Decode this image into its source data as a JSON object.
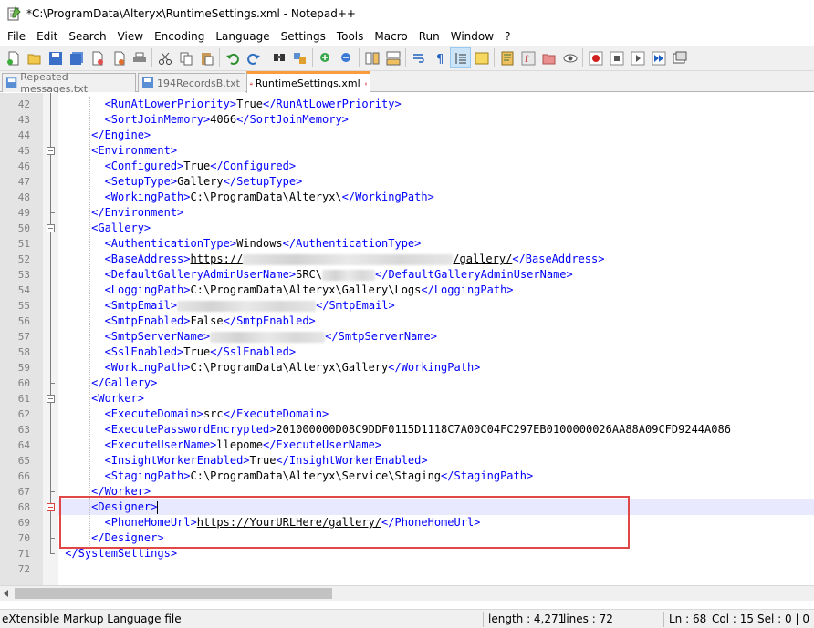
{
  "window": {
    "title": "*C:\\ProgramData\\Alteryx\\RuntimeSettings.xml - Notepad++"
  },
  "menu": [
    "File",
    "Edit",
    "Search",
    "View",
    "Encoding",
    "Language",
    "Settings",
    "Tools",
    "Macro",
    "Run",
    "Window",
    "?"
  ],
  "tabs": [
    {
      "label": "Repeated messages.txt",
      "active": false
    },
    {
      "label": "194RecordsB.txt",
      "active": false
    },
    {
      "label": "RuntimeSettings.xml",
      "active": true
    }
  ],
  "editor": {
    "current_line": 68,
    "lines": [
      {
        "num": "42",
        "segs": [
          [
            "t",
            "<RunAtLowerPriority>"
          ],
          [
            "v",
            "True"
          ],
          [
            "t",
            "</RunAtLowerPriority>"
          ]
        ]
      },
      {
        "num": "43",
        "segs": [
          [
            "t",
            "<SortJoinMemory>"
          ],
          [
            "v",
            "4066"
          ],
          [
            "t",
            "</SortJoinMemory>"
          ]
        ]
      },
      {
        "num": "44",
        "segs": [
          [
            "t",
            "</Engine>"
          ]
        ]
      },
      {
        "num": "45",
        "segs": [
          [
            "t",
            "<Environment>"
          ]
        ]
      },
      {
        "num": "46",
        "segs": [
          [
            "t",
            "<Configured>"
          ],
          [
            "v",
            "True"
          ],
          [
            "t",
            "</Configured>"
          ]
        ]
      },
      {
        "num": "47",
        "segs": [
          [
            "t",
            "<SetupType>"
          ],
          [
            "v",
            "Gallery"
          ],
          [
            "t",
            "</SetupType>"
          ]
        ]
      },
      {
        "num": "48",
        "segs": [
          [
            "t",
            "<WorkingPath>"
          ],
          [
            "v",
            "C:\\ProgramData\\Alteryx\\"
          ],
          [
            "t",
            "</WorkingPath>"
          ]
        ]
      },
      {
        "num": "49",
        "segs": [
          [
            "t",
            "</Environment>"
          ]
        ]
      },
      {
        "num": "50",
        "segs": [
          [
            "t",
            "<Gallery>"
          ]
        ]
      },
      {
        "num": "51",
        "segs": [
          [
            "t",
            "<AuthenticationType>"
          ],
          [
            "v",
            "Windows"
          ],
          [
            "t",
            "</AuthenticationType>"
          ]
        ]
      },
      {
        "num": "52",
        "segs": [
          [
            "t",
            "<BaseAddress>"
          ],
          [
            "u",
            "https://"
          ],
          [
            "b",
            "",
            ""
          ],
          [
            "u",
            "/gallery/"
          ],
          [
            "t",
            "</BaseAddress>"
          ]
        ]
      },
      {
        "num": "53",
        "segs": [
          [
            "t",
            "<DefaultGalleryAdminUserName>"
          ],
          [
            "v",
            "SRC\\"
          ],
          [
            "b",
            "",
            ""
          ],
          [
            "t",
            "</DefaultGalleryAdminUserName>"
          ]
        ]
      },
      {
        "num": "54",
        "segs": [
          [
            "t",
            "<LoggingPath>"
          ],
          [
            "v",
            "C:\\ProgramData\\Alteryx\\Gallery\\Logs"
          ],
          [
            "t",
            "</LoggingPath>"
          ]
        ]
      },
      {
        "num": "55",
        "segs": [
          [
            "t",
            "<SmtpEmail>"
          ],
          [
            "b",
            "",
            ""
          ],
          [
            "t",
            "</SmtpEmail>"
          ]
        ]
      },
      {
        "num": "56",
        "segs": [
          [
            "t",
            "<SmtpEnabled>"
          ],
          [
            "v",
            "False"
          ],
          [
            "t",
            "</SmtpEnabled>"
          ]
        ]
      },
      {
        "num": "57",
        "segs": [
          [
            "t",
            "<SmtpServerName>"
          ],
          [
            "b",
            "",
            ""
          ],
          [
            "t",
            "</SmtpServerName>"
          ]
        ]
      },
      {
        "num": "58",
        "segs": [
          [
            "t",
            "<SslEnabled>"
          ],
          [
            "v",
            "True"
          ],
          [
            "t",
            "</SslEnabled>"
          ]
        ]
      },
      {
        "num": "59",
        "segs": [
          [
            "t",
            "<WorkingPath>"
          ],
          [
            "v",
            "C:\\ProgramData\\Alteryx\\Gallery"
          ],
          [
            "t",
            "</WorkingPath>"
          ]
        ]
      },
      {
        "num": "60",
        "segs": [
          [
            "t",
            "</Gallery>"
          ]
        ]
      },
      {
        "num": "61",
        "segs": [
          [
            "t",
            "<Worker>"
          ]
        ]
      },
      {
        "num": "62",
        "segs": [
          [
            "t",
            "<ExecuteDomain>"
          ],
          [
            "v",
            "src"
          ],
          [
            "t",
            "</ExecuteDomain>"
          ]
        ]
      },
      {
        "num": "63",
        "segs": [
          [
            "t",
            "<ExecutePasswordEncrypted>"
          ],
          [
            "v",
            "201000000D08C9DDF0115D1118C7A00C04FC297EB0100000026AA88A09CFD9244A086"
          ]
        ]
      },
      {
        "num": "64",
        "segs": [
          [
            "t",
            "<ExecuteUserName>"
          ],
          [
            "v",
            "llepome"
          ],
          [
            "t",
            "</ExecuteUserName>"
          ]
        ]
      },
      {
        "num": "65",
        "segs": [
          [
            "t",
            "<InsightWorkerEnabled>"
          ],
          [
            "v",
            "True"
          ],
          [
            "t",
            "</InsightWorkerEnabled>"
          ]
        ]
      },
      {
        "num": "66",
        "segs": [
          [
            "t",
            "<StagingPath>"
          ],
          [
            "v",
            "C:\\ProgramData\\Alteryx\\Service\\Staging"
          ],
          [
            "t",
            "</StagingPath>"
          ]
        ]
      },
      {
        "num": "67",
        "segs": [
          [
            "t",
            "</Worker>"
          ]
        ]
      },
      {
        "num": "68",
        "segs": [
          [
            "t",
            "<Designer>"
          ]
        ]
      },
      {
        "num": "69",
        "segs": [
          [
            "t",
            "<PhoneHomeUrl>"
          ],
          [
            "u",
            "https://YourURLHere/gallery/"
          ],
          [
            "t",
            "</PhoneHomeUrl>"
          ]
        ]
      },
      {
        "num": "70",
        "segs": [
          [
            "t",
            "</Designer>"
          ]
        ]
      },
      {
        "num": "71",
        "segs": [
          [
            "t",
            "</SystemSettings>"
          ]
        ]
      },
      {
        "num": "72",
        "segs": []
      }
    ]
  },
  "status": {
    "file_type": "eXtensible Markup Language file",
    "length": "length : 4,271",
    "lines": "lines : 72",
    "ln": "Ln : 68",
    "col": "Col : 15",
    "sel": "Sel : 0 | 0"
  },
  "toolbar_icons": [
    "new-file-icon",
    "open-file-icon",
    "save-icon",
    "save-all-icon",
    "close-icon",
    "close-all-icon",
    "print-icon",
    "cut-icon",
    "copy-icon",
    "paste-icon",
    "undo-icon",
    "redo-icon",
    "find-icon",
    "replace-icon",
    "zoom-in-icon",
    "zoom-out-icon",
    "sync-vertical-icon",
    "sync-horizontal-icon",
    "word-wrap-icon",
    "show-all-chars-icon",
    "indent-guide-icon",
    "user-lang-icon",
    "doc-map-icon",
    "function-list-icon",
    "folder-workspace-icon",
    "monitoring-icon",
    "record-macro-icon",
    "stop-macro-icon",
    "play-macro-icon",
    "run-macro-multiple-icon",
    "save-macro-icon"
  ]
}
